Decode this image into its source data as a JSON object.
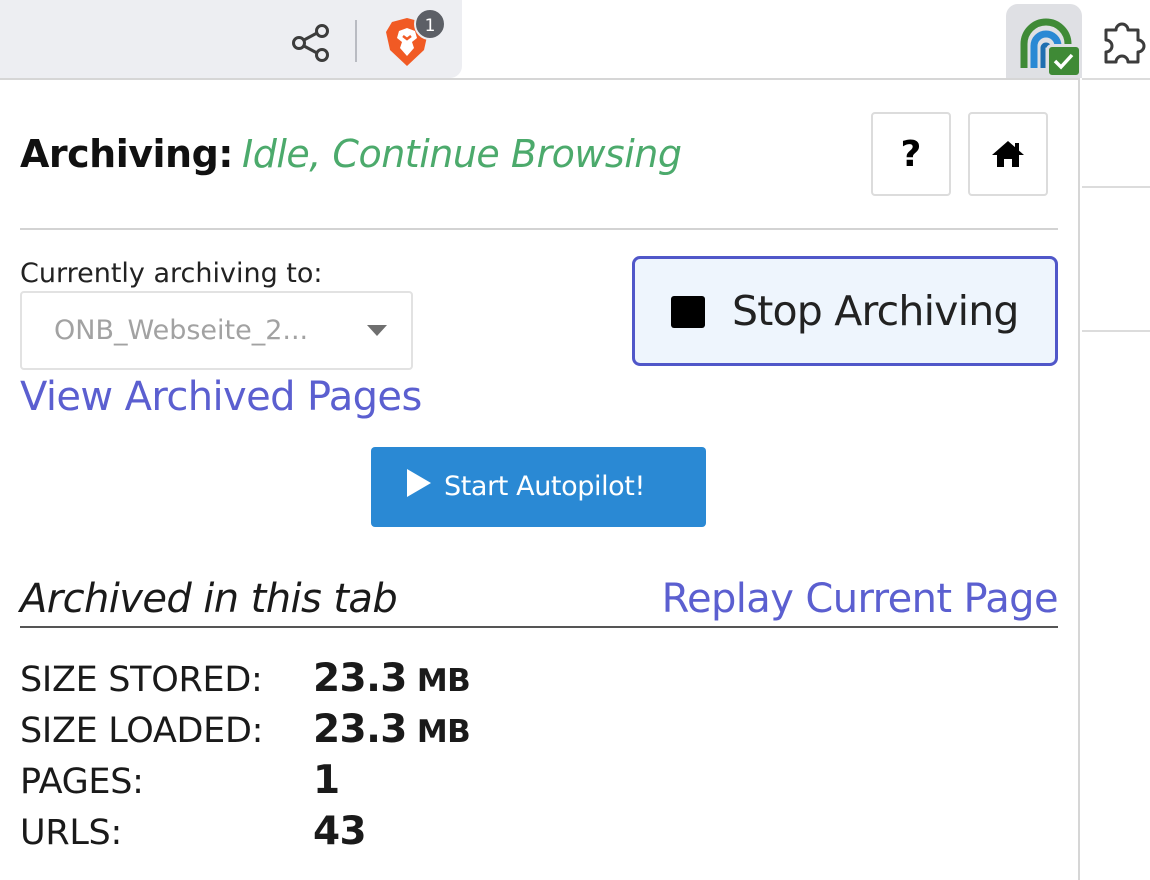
{
  "toolbar": {
    "brave_shields_count": "1",
    "icons": [
      "share-icon",
      "brave-shields-icon",
      "archiveweb-extension-icon",
      "extensions-puzzle-icon"
    ]
  },
  "popup": {
    "status_label": "Archiving:",
    "status_value": "Idle, Continue Browsing",
    "help_label": "?",
    "archiving_to_label": "Currently archiving to:",
    "collection_value": "ONB_Webseite_2...",
    "view_archived_label": "View Archived Pages",
    "stop_label": "Stop Archiving",
    "autopilot_label": "Start Autopilot!",
    "tab_heading": "Archived in this tab",
    "replay_label": "Replay Current Page",
    "stats": {
      "size_stored_label": "SIZE STORED:",
      "size_stored_value": "23.3",
      "size_stored_unit": "MB",
      "size_loaded_label": "SIZE LOADED:",
      "size_loaded_value": "23.3",
      "size_loaded_unit": "MB",
      "pages_label": "PAGES:",
      "pages_value": "1",
      "urls_label": "URLS:",
      "urls_value": "43"
    }
  },
  "colors": {
    "status_idle": "#4caa6c",
    "link": "#5b5fd0",
    "primary_button": "#2a89d4",
    "stop_button_border": "#5057c9",
    "stop_button_bg": "#eef5fd"
  }
}
